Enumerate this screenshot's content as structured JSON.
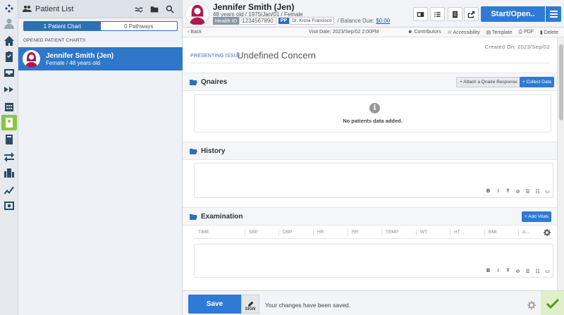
{
  "app": {
    "rail_items": [
      "dashboard-icon",
      "user-icon",
      "home-icon",
      "clipboard-icon",
      "inbox-icon",
      "forward-icon",
      "calendar-icon",
      "patient-chart-icon",
      "book-icon",
      "transfer-icon",
      "building-icon",
      "chart-icon",
      "screen-icon"
    ]
  },
  "patient_list": {
    "title": "Patient List",
    "tab_charts": "1 Patient Chart",
    "tab_pathways": "0 Pathways",
    "opened_label": "OPENED PATIENT CHARTS",
    "card": {
      "name": "Jennifer Smith (Jen)",
      "sub": "Female / 48 years old"
    }
  },
  "header": {
    "name": "Jennifer Smith (Jen)",
    "sub": "48 years old / 1975/Jan/01 / Female",
    "health_id_label": "Health ID",
    "health_id_value": "1234567890",
    "pp_badge": "PP",
    "doctor": "Dr. Krizia Francisco",
    "balance_label": "/ Balance Due:",
    "balance_value": "$0.00",
    "start_label": "Start/Open.."
  },
  "subbar": {
    "back": "‹ Back",
    "visit_date": "Visit Date: 2023/Sep/02 2:00PM",
    "contributors": "Contributors",
    "accessibility": "Accessibility",
    "template": "Template",
    "pdf": "PDF",
    "delete": "Delete"
  },
  "main": {
    "created_on": "Created On: 2023/Sep/02",
    "presenting_issue_label": "PRESENTING ISSUE",
    "presenting_issue_value": "Undefined Concern",
    "qnaires": {
      "title": "Qnaires",
      "attach_label": "+ Attach a Qnaire Response",
      "collect_label": "+ Collect Data",
      "empty_text": "No patients data added."
    },
    "history": {
      "title": "History"
    },
    "examination": {
      "title": "Examination",
      "add_vitals": "+ Add Vitals",
      "vitals_columns": [
        "TIME",
        "SBP",
        "DBP",
        "HR",
        "RR",
        "TEMP",
        "WT",
        "HT",
        "BMI",
        "A..."
      ]
    },
    "editor_tools": [
      "B",
      "I",
      "Ŧ",
      "⊘",
      "☰",
      "☷",
      "▭"
    ]
  },
  "bottom": {
    "save_label": "Save",
    "sign_label": "SIGN",
    "saved_message": "Your changes have been saved."
  },
  "colors": {
    "accent": "#2f7ad4",
    "rail_active": "#8cc63f",
    "card_bg": "#2e77c9"
  }
}
